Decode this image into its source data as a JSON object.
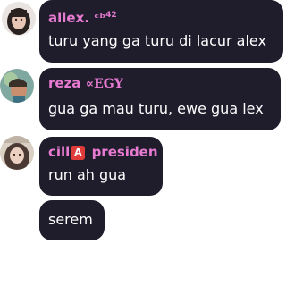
{
  "messages": [
    {
      "username": "allex.",
      "username_suffix": "ᶜᵇ",
      "username_sup": "42",
      "text": "turu yang ga turu di lacur alex",
      "avatar_icon": "user-avatar-photo"
    },
    {
      "username": "reza",
      "username_suffix": "∝E𝐆Y",
      "text": "gua ga mau turu, ewe gua lex",
      "avatar_icon": "user-avatar-photo"
    },
    {
      "username_prefix": "cill",
      "badge": "A",
      "username": "presiden",
      "text": "run ah gua",
      "avatar_icon": "user-avatar-photo"
    },
    {
      "text": "serem"
    }
  ],
  "colors": {
    "bubble": "#1f1c2c",
    "username": "#e77bd1",
    "text": "#ffffff",
    "badge": "#e03b3b"
  }
}
